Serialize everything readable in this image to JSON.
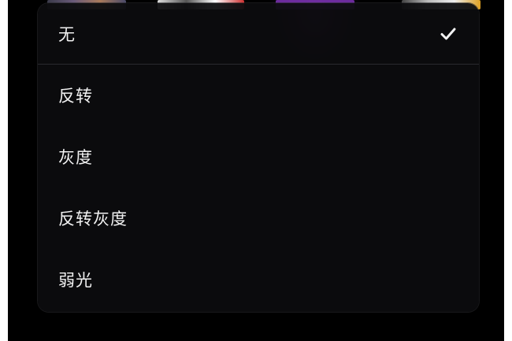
{
  "menu": {
    "items": [
      {
        "label": "无",
        "selected": true
      },
      {
        "label": "反转",
        "selected": false
      },
      {
        "label": "灰度",
        "selected": false
      },
      {
        "label": "反转灰度",
        "selected": false
      },
      {
        "label": "弱光",
        "selected": false
      }
    ],
    "selected_icon": "checkmark-icon"
  },
  "colors": {
    "menu_background": "#0c0c0e",
    "text": "#f2f2f2",
    "divider": "#2a2a2e"
  }
}
